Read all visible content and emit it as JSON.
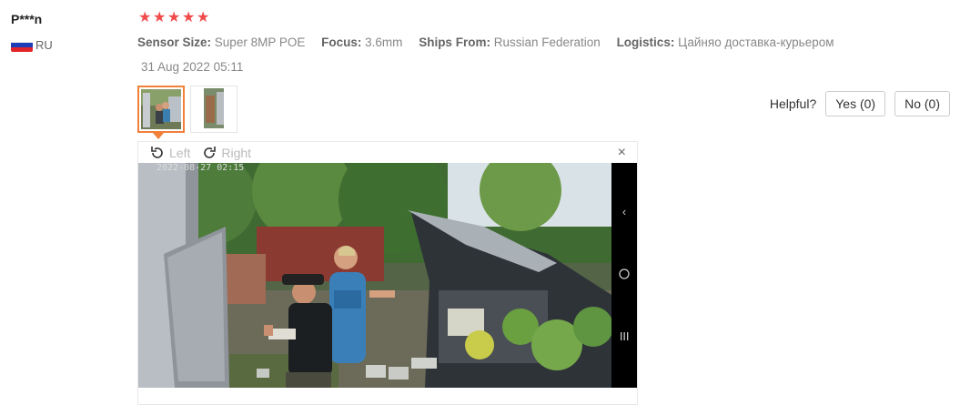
{
  "review": {
    "user_name": "P***n",
    "country": "RU",
    "rating": 5,
    "attributes": [
      {
        "label": "Sensor Size:",
        "value": "Super 8MP POE"
      },
      {
        "label": "Focus:",
        "value": "3.6mm"
      },
      {
        "label": "Ships From:",
        "value": "Russian Federation"
      },
      {
        "label": "Logistics:",
        "value": "Цайняо доставка-курьером"
      }
    ],
    "date": "31 Aug 2022 05:11",
    "helpful_label": "Helpful?",
    "yes_label": "Yes (0)",
    "no_label": "No (0)"
  },
  "viewer": {
    "rotate_left_label": "Left",
    "rotate_right_label": "Right",
    "close_symbol": "×"
  },
  "colors": {
    "star": "#f04a4a",
    "active_thumb_border": "#f0803a"
  },
  "icons": [
    "flag-icon",
    "star-icon",
    "rotate-left-icon",
    "rotate-right-icon",
    "close-icon",
    "chevron-left-icon",
    "home-circle-icon",
    "menu-lines-icon"
  ]
}
